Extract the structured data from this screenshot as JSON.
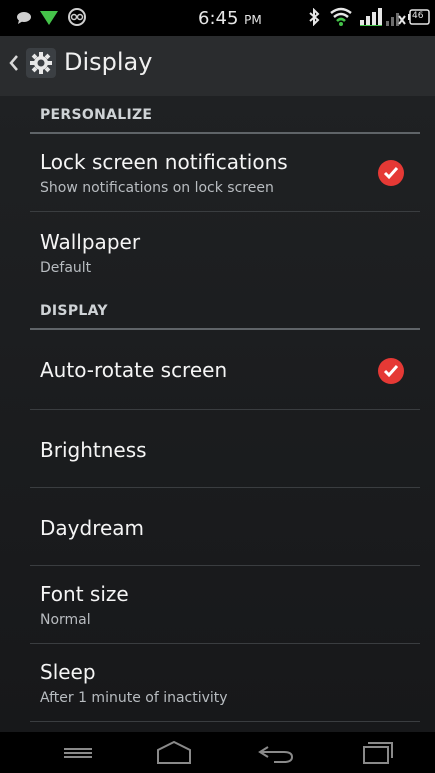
{
  "status_bar": {
    "time": "6:45",
    "ampm": "PM",
    "icons": [
      "message-icon",
      "wifi-down-icon",
      "voicemail-icon",
      "bluetooth-icon",
      "wifi-signal-icon",
      "cell-signal-icon",
      "cell-signal-no-data-icon",
      "battery-icon"
    ],
    "battery_level": "46"
  },
  "action_bar": {
    "title": "Display",
    "back_icon": "chevron-left-icon",
    "app_icon": "gear-icon"
  },
  "sections": [
    {
      "header": "PERSONALIZE",
      "items": [
        {
          "title": "Lock screen notifications",
          "subtitle": "Show notifications on lock screen",
          "checked": true
        },
        {
          "title": "Wallpaper",
          "subtitle": "Default"
        }
      ]
    },
    {
      "header": "DISPLAY",
      "items": [
        {
          "title": "Auto-rotate screen",
          "checked": true
        },
        {
          "title": "Brightness"
        },
        {
          "title": "Daydream"
        },
        {
          "title": "Font size",
          "subtitle": "Normal"
        },
        {
          "title": "Sleep",
          "subtitle": "After 1 minute of inactivity"
        }
      ]
    }
  ],
  "colors": {
    "check_accent": "#e53935",
    "divider": "#5f6468"
  },
  "nav_bar": {
    "buttons": [
      "menu-icon",
      "home-icon",
      "back-icon",
      "recent-apps-icon"
    ]
  }
}
